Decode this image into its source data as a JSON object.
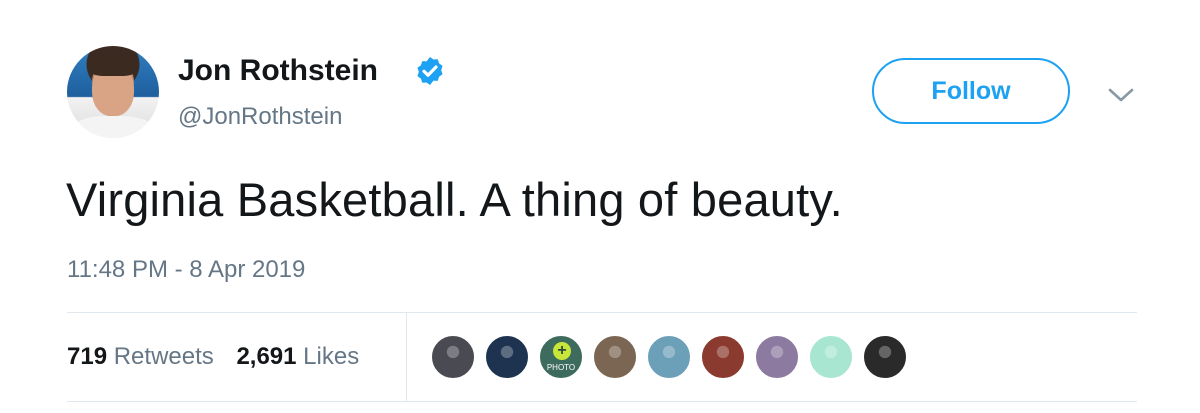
{
  "author": {
    "name": "Jon Rothstein",
    "handle": "@JonRothstein",
    "verified_icon": "verified-badge-icon"
  },
  "actions": {
    "follow_label": "Follow",
    "more_icon": "chevron-down-icon"
  },
  "tweet": {
    "text": "Virginia Basketball. A thing of beauty.",
    "timestamp": "11:48 PM - 8 Apr 2019"
  },
  "stats": {
    "retweets_count": "719",
    "retweets_label": "Retweets",
    "likes_count": "2,691",
    "likes_label": "Likes"
  },
  "liker_avatars": [
    {
      "name": "liker-avatar-1",
      "color": "#4a4a52"
    },
    {
      "name": "liker-avatar-2",
      "color": "#1e3350"
    },
    {
      "name": "liker-avatar-3",
      "color": "#3d6b5e",
      "label": "PHOTO"
    },
    {
      "name": "liker-avatar-4",
      "color": "#7a6652"
    },
    {
      "name": "liker-avatar-5",
      "color": "#6c9fb8"
    },
    {
      "name": "liker-avatar-6",
      "color": "#8a3a2e"
    },
    {
      "name": "liker-avatar-7",
      "color": "#8c7aa0"
    },
    {
      "name": "liker-avatar-8",
      "color": "#a8e6d2"
    },
    {
      "name": "liker-avatar-9",
      "color": "#2a2a2a"
    }
  ],
  "colors": {
    "accent": "#1da1f2",
    "text_primary": "#14171a",
    "text_secondary": "#657786",
    "divider": "#e1e8ed"
  }
}
